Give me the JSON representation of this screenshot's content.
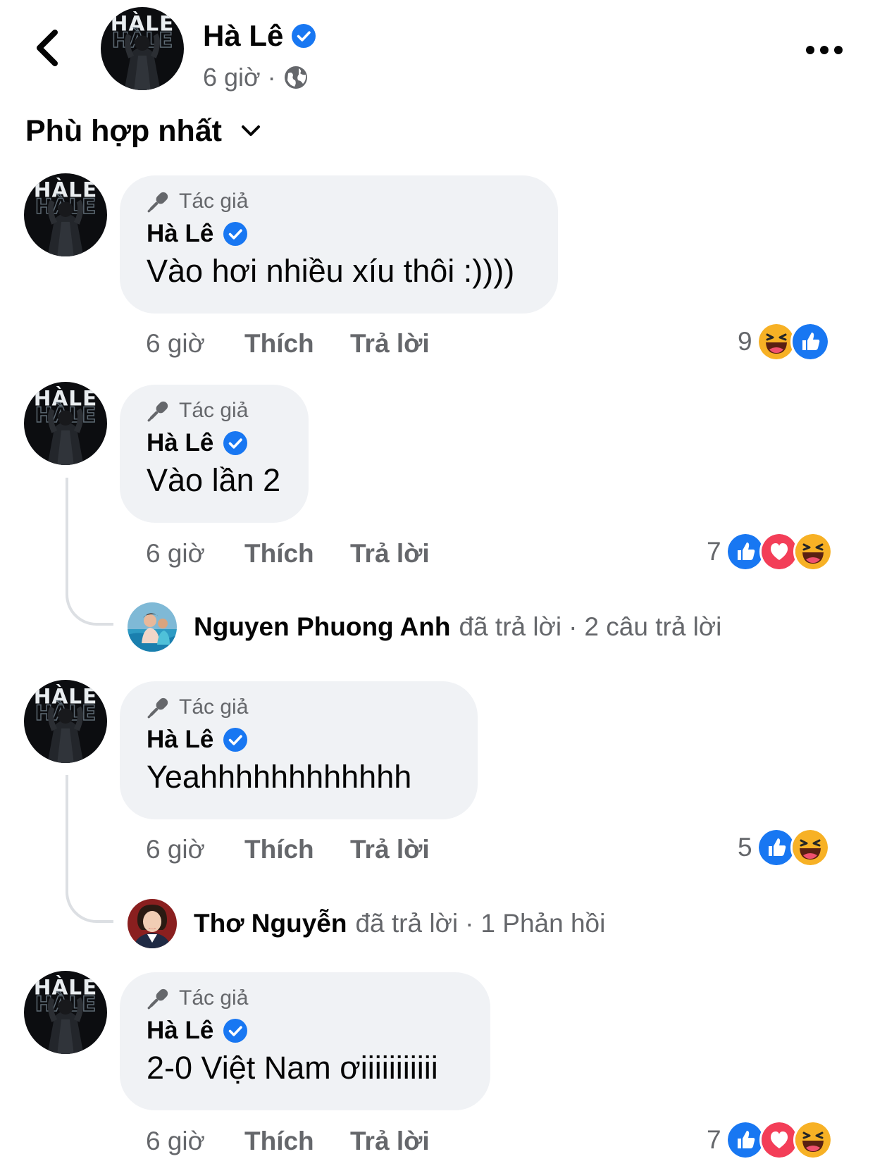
{
  "header": {
    "name": "Hà Lê",
    "time": "6 giờ",
    "separator": "·",
    "avatar_text": "HÀLE"
  },
  "sort": {
    "label": "Phù hợp nhất"
  },
  "comments": [
    {
      "badge": "Tác giả",
      "author": "Hà Lê",
      "text": "Vào hơi nhiều xíu thôi :))))",
      "time": "6 giờ",
      "like": "Thích",
      "reply": "Trả lời",
      "reaction_count": "9",
      "reactions": [
        "haha",
        "like"
      ]
    },
    {
      "badge": "Tác giả",
      "author": "Hà Lê",
      "text": "Vào lần 2",
      "time": "6 giờ",
      "like": "Thích",
      "reply": "Trả lời",
      "reaction_count": "7",
      "reactions": [
        "like",
        "love",
        "haha"
      ],
      "replies_summary": {
        "name": "Nguyen Phuong Anh",
        "action": "đã trả lời",
        "separator": "·",
        "count": "2 câu trả lời"
      }
    },
    {
      "badge": "Tác giả",
      "author": "Hà Lê",
      "text": "Yeahhhhhhhhhhhh",
      "time": "6 giờ",
      "like": "Thích",
      "reply": "Trả lời",
      "reaction_count": "5",
      "reactions": [
        "like",
        "haha"
      ],
      "replies_summary": {
        "name": "Thơ Nguyễn",
        "action": "đã trả lời",
        "separator": "·",
        "count": "1 Phản hồi"
      }
    },
    {
      "badge": "Tác giả",
      "author": "Hà Lê",
      "text": "2-0 Việt Nam ơiiiiiiiiiii",
      "time": "6 giờ",
      "like": "Thích",
      "reply": "Trả lời",
      "reaction_count": "7",
      "reactions": [
        "like",
        "love",
        "haha"
      ]
    }
  ],
  "colors": {
    "verified": "#1877f2",
    "bubble": "#f0f2f5",
    "secondary_text": "#65676b",
    "love": "#f33e58",
    "haha": "#f7b125"
  },
  "icons": [
    "back-arrow-icon",
    "verified-icon",
    "globe-icon",
    "more-icon",
    "chevron-down-icon",
    "microphone-icon",
    "like-reaction-icon",
    "love-reaction-icon",
    "haha-reaction-icon"
  ]
}
